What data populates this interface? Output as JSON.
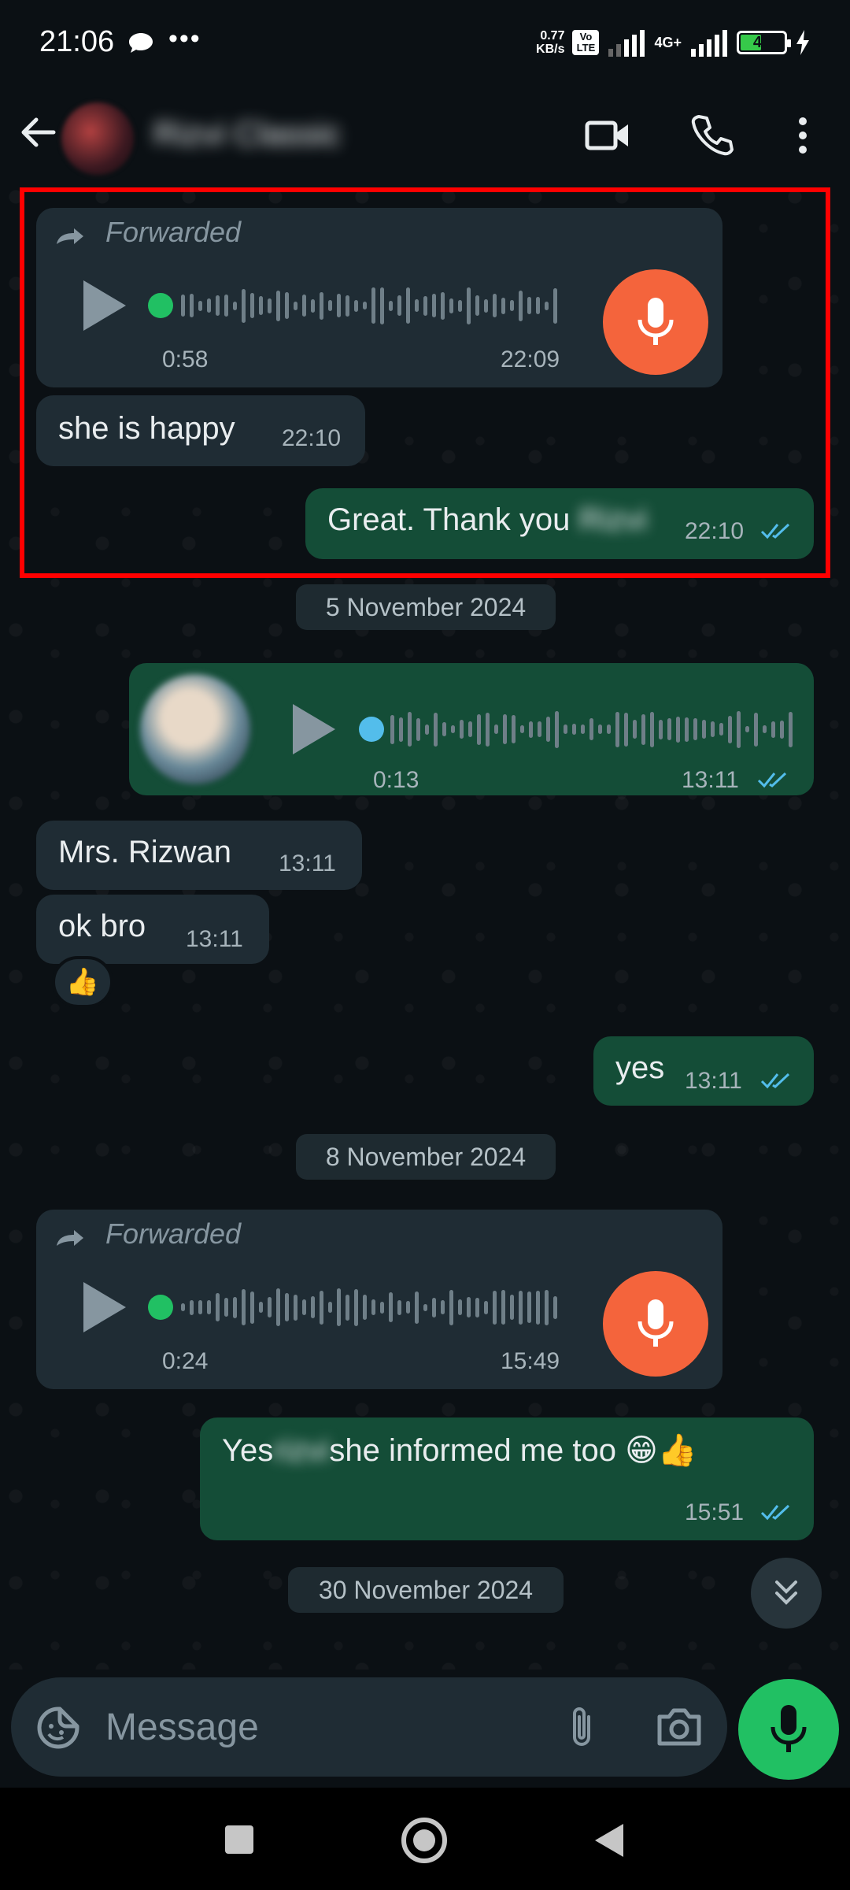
{
  "status_bar": {
    "time": "21:06",
    "speed_value": "0.77",
    "speed_unit": "KB/s",
    "volte_tag": "Vo LTE",
    "network": "4G+",
    "battery": "44"
  },
  "header": {
    "contact_name": "Rizvi Classic"
  },
  "messages": {
    "m1": {
      "forwarded_label": "Forwarded",
      "duration": "0:58",
      "time": "22:09"
    },
    "m2": {
      "text": "she is happy",
      "time": "22:10"
    },
    "m3": {
      "text_prefix": "Great. Thank you",
      "blurred_word": "Rizvi",
      "time": "22:10"
    },
    "date1": "5 November 2024",
    "m4": {
      "duration": "0:13",
      "time": "13:11"
    },
    "m5": {
      "text": "Mrs. Rizwan",
      "time": "13:11"
    },
    "m6": {
      "text": "ok bro",
      "time": "13:11",
      "reaction": "👍"
    },
    "m7": {
      "text": "yes",
      "time": "13:11"
    },
    "date2": "8 November 2024",
    "m8": {
      "forwarded_label": "Forwarded",
      "duration": "0:24",
      "time": "15:49"
    },
    "m9": {
      "text_prefix": "Yes",
      "blurred_word": "rizvi",
      "text_suffix": "she informed me too 😁👍",
      "time": "15:51"
    },
    "date3": "30 November 2024"
  },
  "composer": {
    "placeholder": "Message"
  },
  "colors": {
    "outgoing": "#144d37",
    "incoming": "#1f2c34",
    "accent_green": "#21c063",
    "read_ticks": "#53bdeb",
    "highlight": "#ff0000"
  }
}
